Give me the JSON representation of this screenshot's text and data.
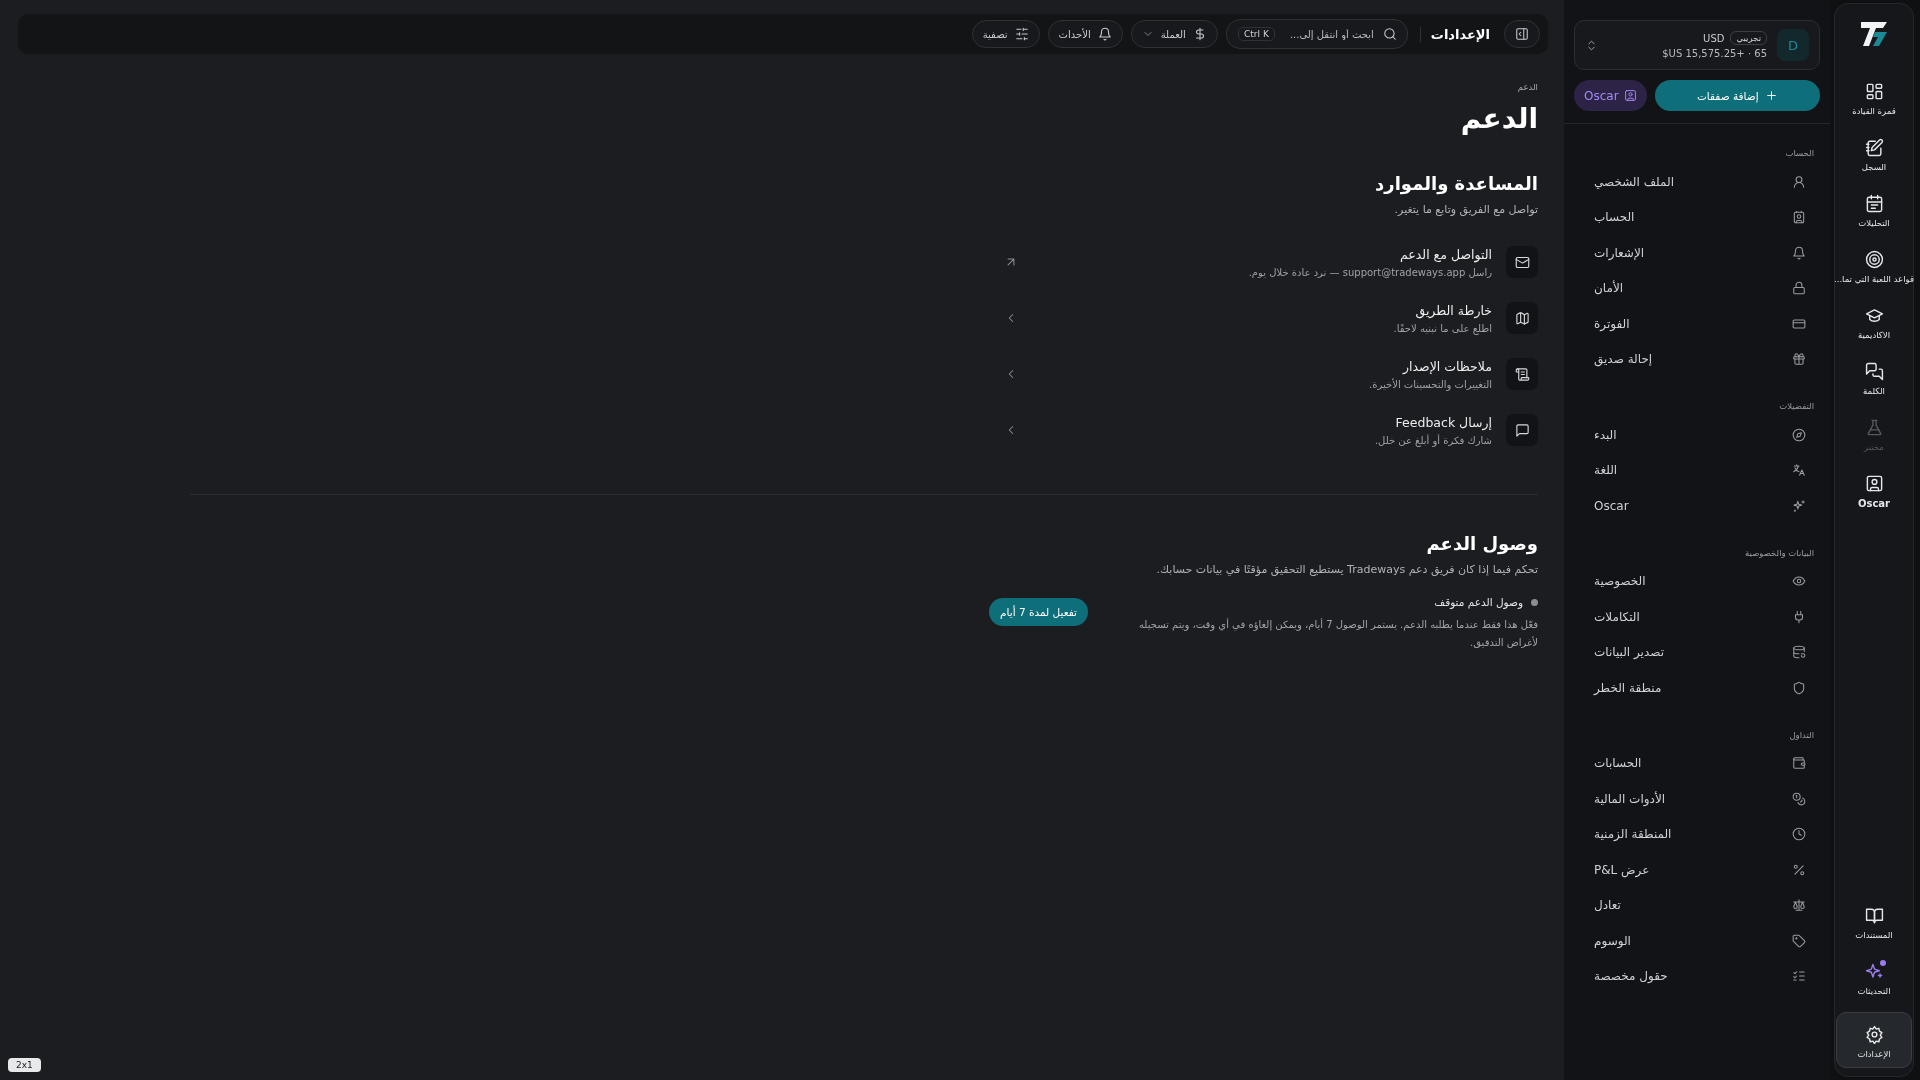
{
  "rail": {
    "items": [
      {
        "label": "قمرة القيادة",
        "selected": false,
        "disabled": false
      },
      {
        "label": "السجل",
        "selected": false,
        "disabled": false
      },
      {
        "label": "التحليلات",
        "selected": false,
        "disabled": false
      },
      {
        "label": "قواعد اللعبة التي تما...",
        "selected": false,
        "disabled": false
      },
      {
        "label": "الاكاديمية",
        "selected": false,
        "disabled": false
      },
      {
        "label": "الكلمة",
        "selected": false,
        "disabled": false
      },
      {
        "label": "مختبر",
        "selected": false,
        "disabled": true
      },
      {
        "label": "Oscar",
        "selected": false,
        "disabled": false
      }
    ],
    "bottom_items": [
      {
        "label": "المستندات",
        "selected": false,
        "unread": false
      },
      {
        "label": "التحديثات",
        "selected": false,
        "unread": true
      },
      {
        "label": "الإعدادات",
        "selected": true,
        "unread": false
      }
    ]
  },
  "account": {
    "avatar": "D",
    "badge": "تجريبي",
    "currency": "USD",
    "balance": "$US 15,575.25+ · 65"
  },
  "actions": {
    "add_trades": "إضافة صفقات",
    "oscar": "Oscar"
  },
  "sidebar": {
    "sections": [
      {
        "title": "الحساب",
        "items": [
          "الملف الشخصي",
          "الحساب",
          "الإشعارات",
          "الأمان",
          "الفوترة",
          "إحالة صديق"
        ]
      },
      {
        "title": "التفضيلات",
        "items": [
          "البدء",
          "اللغة",
          "Oscar"
        ]
      },
      {
        "title": "البيانات والخصوصية",
        "items": [
          "الخصوصية",
          "التكاملات",
          "تصدير البيانات",
          "منطقة الخطر"
        ]
      },
      {
        "title": "التداول",
        "items": [
          "الحسابات",
          "الأدوات المالية",
          "المنطقة الزمنية",
          "عرض P&L",
          "تعادل",
          "الوسوم",
          "حقول مخصصة"
        ]
      }
    ]
  },
  "top_bar": {
    "title": "الإعدادات",
    "search": {
      "placeholder": "ابحث أو انتقل إلى...",
      "shortcut": "Ctrl K"
    },
    "currency": "العملة",
    "events": "الأحداث",
    "filter": "تصفية"
  },
  "page": {
    "breadcrumb": "الدعم",
    "title": "الدعم",
    "help": {
      "title": "المساعدة والموارد",
      "subtitle": "تواصل مع الفريق وتابع ما يتغير.",
      "links": [
        {
          "kind": "external",
          "title": "التواصل مع الدعم",
          "description": "راسل support@tradeways.app — نرد عادة خلال يوم."
        },
        {
          "kind": "internal",
          "title": "خارطة الطريق",
          "description": "اطلع على ما نبنيه لاحقًا."
        },
        {
          "kind": "internal",
          "title": "ملاحظات الإصدار",
          "description": "التغييرات والتحسينات الأخيرة."
        },
        {
          "kind": "internal",
          "title": "إرسال Feedback",
          "description": "شارك فكرة أو أبلغ عن خلل."
        }
      ]
    },
    "access": {
      "title": "وصول الدعم",
      "subtitle": "تحكم فيما إذا كان فريق دعم Tradeways يستطيع التحقيق مؤقتًا في بيانات حسابك.",
      "status": "وصول الدعم متوقف",
      "active": false,
      "description": "فعّل هذا فقط عندما يطلبه الدعم. يستمر الوصول 7 أيام، ويمكن إلغاؤه في أي وقت، ويتم تسجيله لأغراض التدقيق.",
      "button": "تفعيل لمدة 7 أيام"
    }
  },
  "corner_badge": "2x1"
}
